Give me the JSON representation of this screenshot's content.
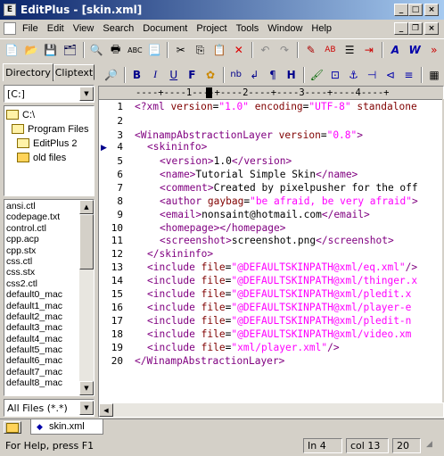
{
  "window": {
    "title": "EditPlus - [skin.xml]",
    "doc_icon": "xml-doc-icon"
  },
  "menu": [
    "File",
    "Edit",
    "View",
    "Search",
    "Document",
    "Project",
    "Tools",
    "Window",
    "Help"
  ],
  "format_toolbar": {
    "bold": "B",
    "italic": "I",
    "underline": "U",
    "font": "F",
    "html_nb": "nb",
    "html_p": "¶",
    "html_h": "H"
  },
  "sidebar": {
    "tabs": [
      "Directory",
      "Cliptext"
    ],
    "drive": "[C:]",
    "tree": [
      "C:\\",
      "Program Files",
      "EditPlus 2",
      "old files"
    ],
    "files": [
      "ansi.ctl",
      "codepage.txt",
      "control.ctl",
      "cpp.acp",
      "cpp.stx",
      "css.ctl",
      "css.stx",
      "css2.ctl",
      "default0_mac",
      "default1_mac",
      "default2_mac",
      "default3_mac",
      "default4_mac",
      "default5_mac",
      "default6_mac",
      "default7_mac",
      "default8_mac"
    ],
    "filter": "All Files (*.*)"
  },
  "ruler": "----+----1----+----2----+----3----+----4----+",
  "editor": {
    "line_numbers": [
      "1",
      "2",
      "3",
      "4",
      "5",
      "6",
      "7",
      "8",
      "9",
      "10",
      "11",
      "12",
      "13",
      "14",
      "15",
      "16",
      "17",
      "18",
      "19",
      "20"
    ],
    "current_line": 4
  },
  "doc_tab": "skin.xml",
  "status": {
    "help": "For Help, press F1",
    "line": "In 4",
    "col": "col 13",
    "num": "20"
  }
}
